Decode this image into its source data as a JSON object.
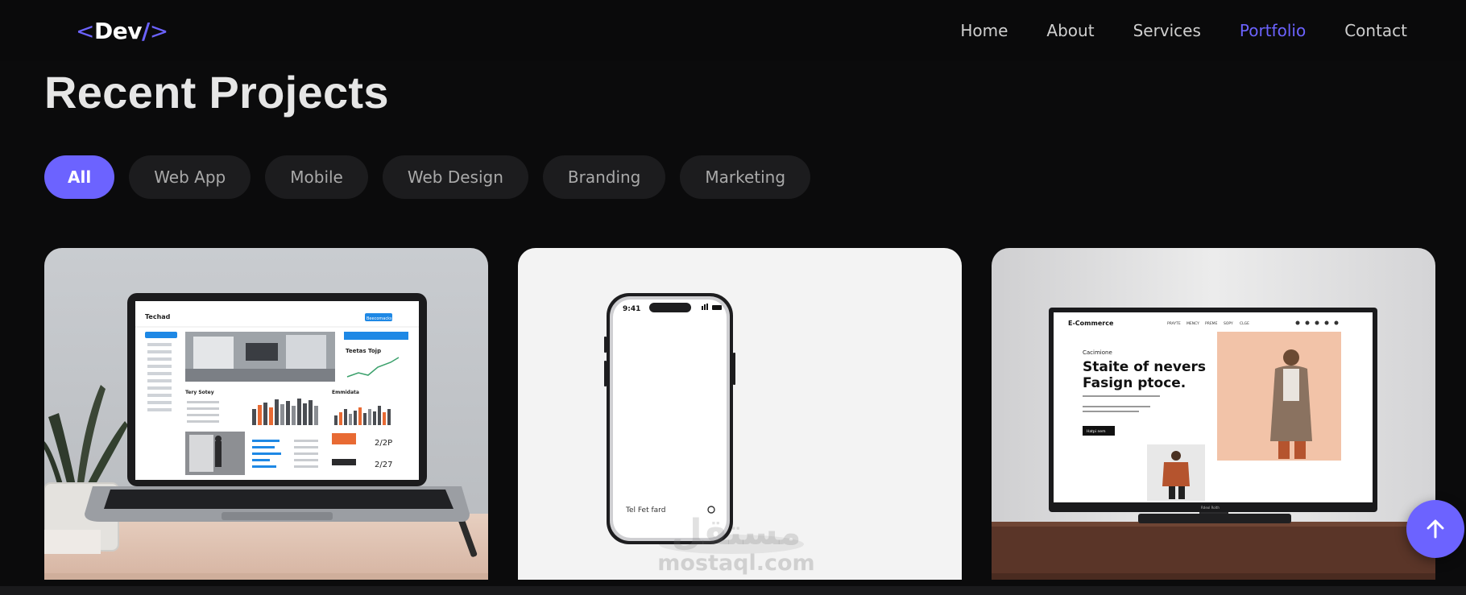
{
  "nav": {
    "logo": {
      "open": "<",
      "text": "Dev",
      "slash": "/",
      "close": ">"
    },
    "links": [
      {
        "label": "Home",
        "active": false
      },
      {
        "label": "About",
        "active": false
      },
      {
        "label": "Services",
        "active": false
      },
      {
        "label": "Portfolio",
        "active": true
      },
      {
        "label": "Contact",
        "active": false
      }
    ]
  },
  "section": {
    "title": "Recent Projects"
  },
  "filters": [
    {
      "label": "All",
      "active": true
    },
    {
      "label": "Web App",
      "active": false
    },
    {
      "label": "Mobile",
      "active": false
    },
    {
      "label": "Web Design",
      "active": false
    },
    {
      "label": "Branding",
      "active": false
    },
    {
      "label": "Marketing",
      "active": false
    }
  ],
  "projects": [
    {
      "image": "laptop-dashboard",
      "screen_brand": "Techad",
      "screen_search": "Beecomacks",
      "screen_card_title": "Teetas Tojp",
      "screen_section": "Tery Sotey",
      "screen_section2": "Emmidata",
      "screen_value1": "2/2P",
      "screen_value2": "2/27"
    },
    {
      "image": "phone-mockup",
      "phone_time": "9:41",
      "phone_input": "Tel Fet fard"
    },
    {
      "image": "monitor-ecommerce",
      "site_brand": "E-Commerce",
      "site_nav": [
        "PRAYTE",
        "MENCY",
        "PREME",
        "SOPY",
        "CLGE"
      ],
      "hero_kicker": "Cacimione",
      "hero_title_line1": "Staite of nevers",
      "hero_title_line2": "Fasign ptoce.",
      "hero_button": "Hatpi nem",
      "monitor_brand": "Rdeol Rolth"
    }
  ],
  "watermark": {
    "arabic": "مستقل",
    "latin": "mostaql.com"
  },
  "colors": {
    "accent": "#6c63ff",
    "background": "#0b0b0c",
    "chip": "#1c1c1e"
  },
  "icons": {
    "back_to_top": "arrow-up-icon"
  }
}
